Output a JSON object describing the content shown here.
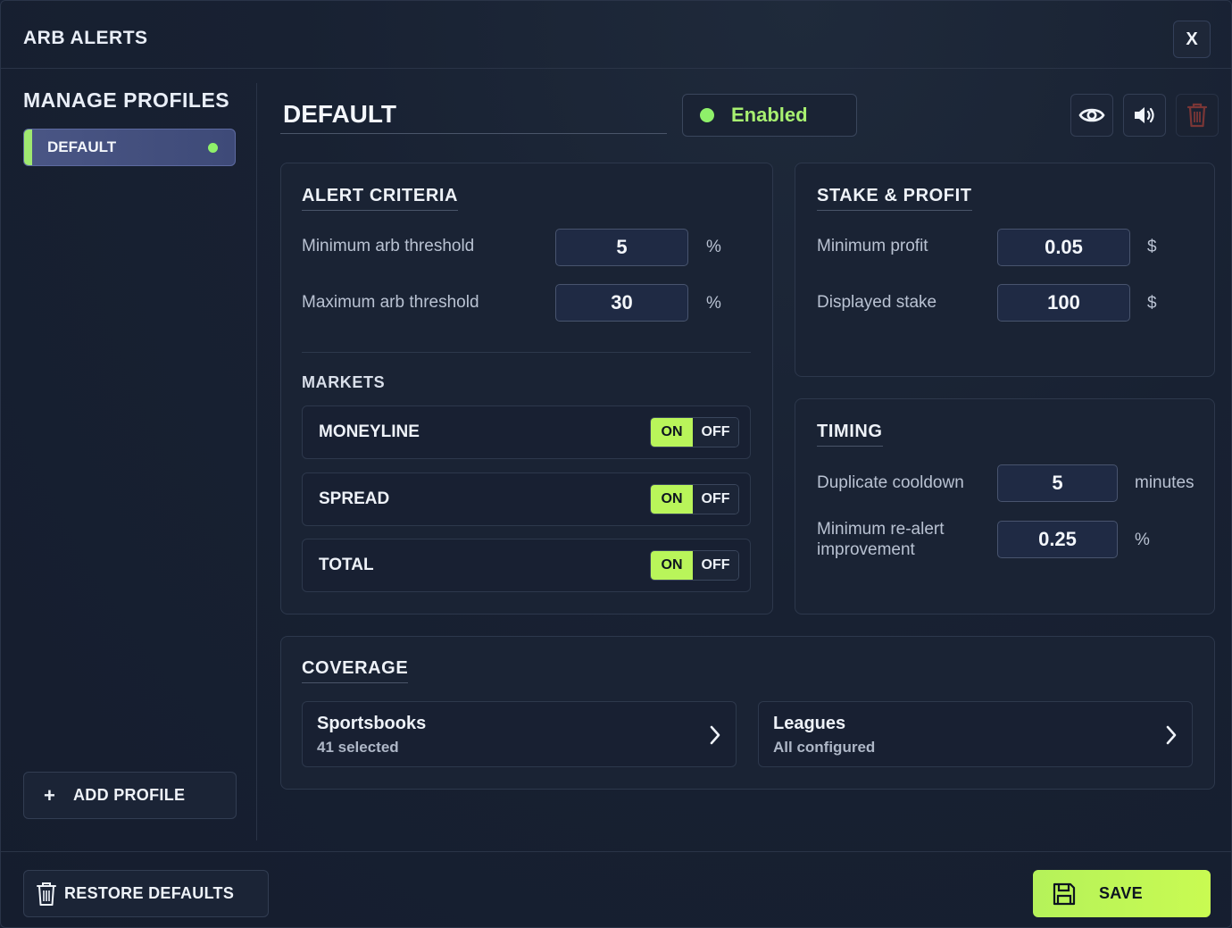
{
  "window": {
    "title": "ARB ALERTS",
    "close_label": "X"
  },
  "sidebar": {
    "title": "MANAGE PROFILES",
    "profiles": [
      {
        "label": "DEFAULT",
        "active": true
      }
    ],
    "add_profile_label": "ADD PROFILE",
    "add_profile_icon": "+"
  },
  "profile": {
    "name": "DEFAULT",
    "status_label": "Enabled",
    "status_color": "#8ff06a",
    "actions": [
      "eye-icon",
      "speaker-icon",
      "trash-icon"
    ]
  },
  "alert_criteria": {
    "title": "ALERT CRITERIA",
    "fields": [
      {
        "label": "Minimum arb threshold",
        "value": "5",
        "unit": "%"
      },
      {
        "label": "Maximum arb threshold",
        "value": "30",
        "unit": "%"
      }
    ]
  },
  "markets": {
    "title": "MARKETS",
    "on_label": "ON",
    "off_label": "OFF",
    "items": [
      {
        "name": "MONEYLINE",
        "state": "ON"
      },
      {
        "name": "SPREAD",
        "state": "ON"
      },
      {
        "name": "TOTAL",
        "state": "ON"
      }
    ]
  },
  "stake_profit": {
    "title": "STAKE & PROFIT",
    "fields": [
      {
        "label": "Minimum profit",
        "value": "0.05",
        "unit": "$"
      },
      {
        "label": "Displayed stake",
        "value": "100",
        "unit": "$"
      }
    ]
  },
  "timing": {
    "title": "TIMING",
    "fields": [
      {
        "label": "Duplicate cooldown",
        "value": "5",
        "unit": "minutes"
      },
      {
        "label": "Minimum re-alert improvement",
        "value": "0.25",
        "unit": "%"
      }
    ]
  },
  "coverage": {
    "title": "COVERAGE",
    "items": [
      {
        "title": "Sportsbooks",
        "subtitle": "41 selected"
      },
      {
        "title": "Leagues",
        "subtitle": "All configured"
      }
    ]
  },
  "footer": {
    "restore_label": "RESTORE DEFAULTS",
    "save_label": "SAVE"
  },
  "colors": {
    "accent": "#b9f55a",
    "background": "#172033",
    "danger_icon": "#8a3a3a"
  }
}
